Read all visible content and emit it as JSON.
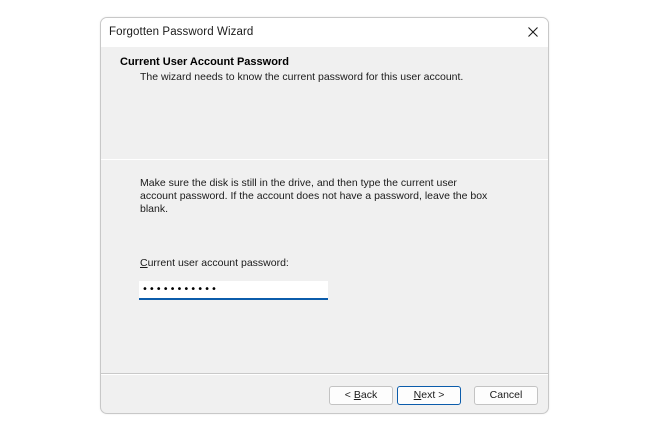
{
  "window": {
    "title": "Forgotten Password Wizard"
  },
  "header": {
    "title": "Current User Account Password",
    "description": "The wizard needs to know the current password for this user account."
  },
  "body": {
    "instructions": "Make sure the disk is still in the drive, and then type the current user account password. If the account does not have a password, leave the box blank.",
    "password_label_prefix": "",
    "password_label_accel": "C",
    "password_label_rest": "urrent user account password:",
    "password_value": "•••••••••••"
  },
  "buttons": {
    "back_prefix": "< ",
    "back_accel": "B",
    "back_rest": "ack",
    "next_accel": "N",
    "next_rest": "ext >",
    "cancel": "Cancel"
  },
  "icons": {
    "close": "close-icon"
  },
  "colors": {
    "accent": "#0b5cab",
    "dialog_bg": "#f0f0f0"
  }
}
